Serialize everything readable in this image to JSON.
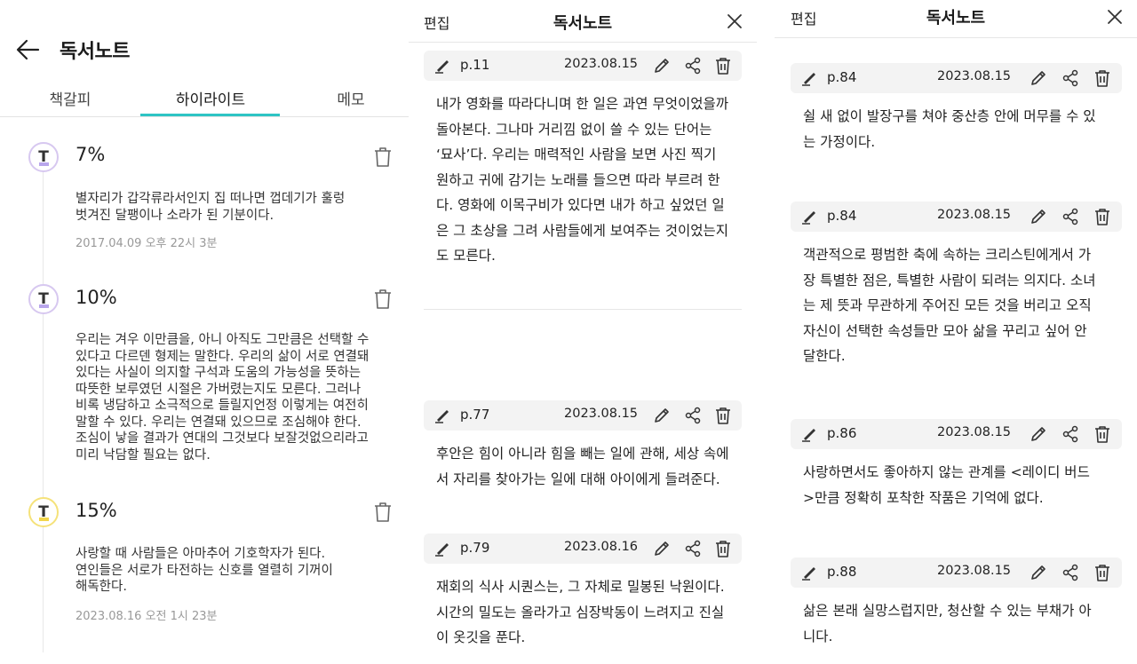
{
  "panel1": {
    "title": "독서노트",
    "tabs": [
      "책갈피",
      "하이라이트",
      "메모"
    ],
    "items": [
      {
        "percent": "7%",
        "text": "별자리가 갑각류라서인지 집 떠나면 껍데기가 훌렁\n벗겨진 달팽이나 소라가 된 기분이다.",
        "date": "2017.04.09 오후 22시 3분",
        "color": "purple"
      },
      {
        "percent": "10%",
        "text": "우리는 겨우 이만큼을, 아니 아직도 그만큼은 선택할 수\n있다고 다르덴 형제는 말한다. 우리의 삶이 서로 연결돼\n있다는 사실이 의지할 구석과 도움의 가능성을 뜻하는\n따뜻한 보루였던 시절은 가버렸는지도 모른다. 그러나\n비록 냉담하고 소극적으로 들릴지언정 이렇게는 여전히\n말할 수 있다. 우리는 연결돼 있으므로 조심해야 한다.\n조심이 낳을 결과가 연대의 그것보다 보잘것없으리라고\n미리 낙담할 필요는 없다.",
        "date": "",
        "color": "purple"
      },
      {
        "percent": "15%",
        "text": "사랑할 때 사람들은 아마추어 기호학자가 된다.\n연인들은 서로가 타전하는 신호를 열렬히 기꺼이\n해독한다.",
        "date": "2023.08.16 오전 1시 23분",
        "color": "yellow"
      }
    ]
  },
  "panel2": {
    "edit_label": "편집",
    "title": "독서노트",
    "notes": [
      {
        "page": "p.11",
        "date": "2023.08.15",
        "text": "내가 영화를 따라다니며 한 일은 과연 무엇이었을까\n돌아본다. 그나마 거리낌 없이 쓸 수 있는 단어는\n‘묘사’다. 우리는 매력적인 사람을 보면 사진 찍기\n원하고 귀에 감기는 노래를 들으면 따라 부르려 한\n다. 영화에 이목구비가 있다면 내가 하고 싶었던 일\n은 그 초상을 그려 사람들에게 보여주는 것이었는지\n도 모른다."
      },
      {
        "page": "p.77",
        "date": "2023.08.15",
        "text": "후안은 힘이 아니라 힘을 빼는 일에 관해, 세상 속에\n서 자리를 찾아가는 일에 대해 아이에게 들려준다."
      },
      {
        "page": "p.79",
        "date": "2023.08.16",
        "text": "재회의 식사 시퀀스는, 그 자체로 밀봉된 낙원이다.\n시간의 밀도는 올라가고 심장박동이 느려지고 진실\n이 옷깃을 푼다."
      }
    ]
  },
  "panel3": {
    "edit_label": "편집",
    "title": "독서노트",
    "notes": [
      {
        "page": "p.84",
        "date": "2023.08.15",
        "text": "쉴 새 없이 발장구를 쳐야 중산층 안에 머무를 수 있\n는 가정이다."
      },
      {
        "page": "p.84",
        "date": "2023.08.15",
        "text": "객관적으로 평범한 축에 속하는 크리스틴에게서 가\n장 특별한 점은, 특별한 사람이 되려는 의지다. 소녀\n는 제 뜻과 무관하게 주어진 모든 것을 버리고 오직\n자신이 선택한 속성들만 모아 삶을 꾸리고 싶어 안\n달한다."
      },
      {
        "page": "p.86",
        "date": "2023.08.15",
        "text": "사랑하면서도 좋아하지 않는 관계를 <레이디 버드\n>만큼 정확히 포착한 작품은 기억에 없다."
      },
      {
        "page": "p.88",
        "date": "2023.08.15",
        "text": "삶은 본래 실망스럽지만, 청산할 수 있는 부채가 아\n니다."
      }
    ]
  },
  "icons": {
    "back": "arrow-left-icon",
    "trash": "trash-icon",
    "pen": "highlighter-pen-icon",
    "edit": "pencil-icon",
    "share": "share-icon",
    "close": "close-icon"
  },
  "colors": {
    "accent": "#2ec4c4",
    "purple_marker": "#b9a6ec",
    "yellow_marker": "#f2d64b"
  }
}
